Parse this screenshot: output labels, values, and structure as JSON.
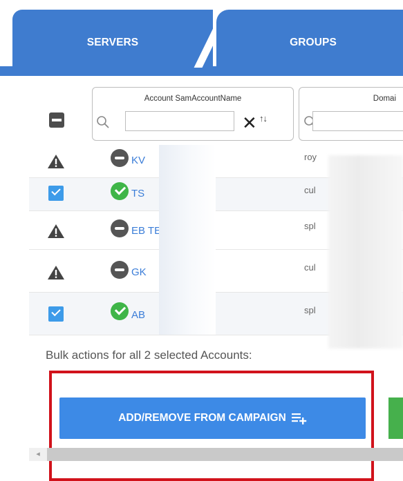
{
  "tabs": [
    "SERVERS",
    "GROUPS"
  ],
  "columns": {
    "account": {
      "title": "Account SamAccountName",
      "filter_value": ""
    },
    "domain": {
      "title": "Domai",
      "filter_value": ""
    }
  },
  "rows": [
    {
      "state": "warning",
      "status": "disabled",
      "account": "KV",
      "domain": "roy"
    },
    {
      "state": "checked",
      "status": "enabled",
      "account": "TS",
      "domain": "cul"
    },
    {
      "state": "warning",
      "status": "disabled",
      "account": "EB          TE",
      "domain": "spl"
    },
    {
      "state": "warning",
      "status": "disabled",
      "account": "GK",
      "domain": "cul"
    },
    {
      "state": "checked",
      "status": "enabled",
      "account": "AB",
      "domain": "spl"
    }
  ],
  "bulk": {
    "text": "Bulk actions for all 2 selected Accounts:",
    "add_remove_label": "ADD/REMOVE FROM CAMPAIGN"
  },
  "colors": {
    "accent": "#3f7ccf",
    "link": "#3b7dd8",
    "highlight": "#d1121b",
    "success": "#3fb548"
  },
  "icons": [
    "select-all-minus-icon",
    "search-icon",
    "close-icon",
    "sort-icon",
    "warning-icon",
    "checkbox-icon",
    "disabled-status-icon",
    "enabled-status-icon",
    "playlist-add-icon"
  ]
}
